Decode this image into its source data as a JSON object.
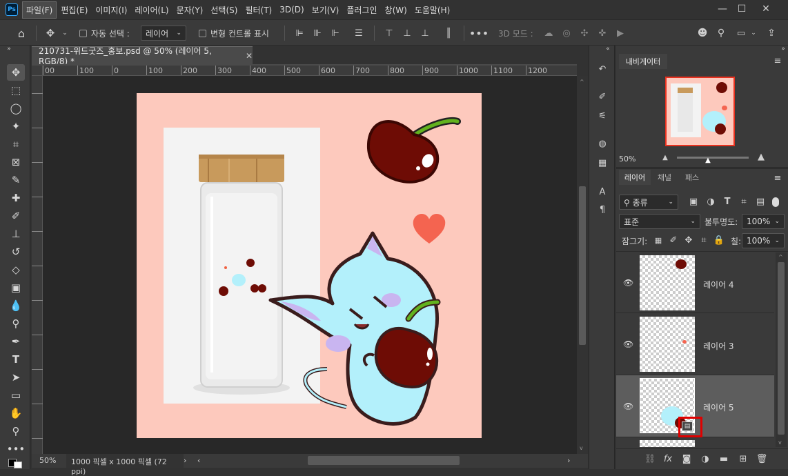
{
  "app": {
    "logo": "Ps"
  },
  "menu": [
    "파일(F)",
    "편집(E)",
    "이미지(I)",
    "레이어(L)",
    "문자(Y)",
    "선택(S)",
    "필터(T)",
    "3D(D)",
    "보기(V)",
    "플러그인",
    "창(W)",
    "도움말(H)"
  ],
  "options": {
    "auto_select_label": "자동 선택 :",
    "auto_select_value": "레이어",
    "transform_label": "변형 컨트롤 표시",
    "mode_3d_label": "3D 모드 :"
  },
  "document": {
    "tab_title": "210731-위드굿즈_홍보.psd @ 50% (레이어 5, RGB/8) *",
    "zoom": "50%",
    "info": "1000 픽셀 x 1000 픽셀 (72 ppi)"
  },
  "ruler": {
    "h_labels": [
      "00",
      "100",
      "0",
      "100",
      "200",
      "300",
      "400",
      "500",
      "600",
      "700",
      "800",
      "900",
      "1000",
      "1100",
      "1200"
    ]
  },
  "navigator": {
    "title": "내비게이터",
    "zoom": "50%"
  },
  "layers_panel": {
    "tabs": [
      "레이어",
      "채널",
      "패스"
    ],
    "filter_label": "종류",
    "blend_mode": "표준",
    "opacity_label": "불투명도:",
    "opacity_value": "100%",
    "lock_label": "잠그기:",
    "fill_label": "칠:",
    "fill_value": "100%",
    "layers": [
      {
        "name": "레이어 4"
      },
      {
        "name": "레이어 3"
      },
      {
        "name": "레이어 5"
      }
    ]
  },
  "colors": {
    "canvas_bg": "#fdc9bd",
    "highlight": "#e00000",
    "cat": "#b3f0fb",
    "cherry": "#6e0c05"
  }
}
